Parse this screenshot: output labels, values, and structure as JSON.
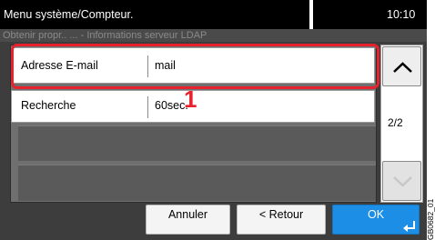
{
  "header": {
    "title": "Menu système/Compteur.",
    "time": "10:10",
    "subtitle": "Obtenir propr.. ... - Informations serveur LDAP"
  },
  "rows": [
    {
      "label": "Adresse E-mail",
      "value": "mail"
    },
    {
      "label": "Recherche",
      "value": "60sec."
    }
  ],
  "callout": "1",
  "pager": {
    "page": "2/2"
  },
  "buttons": {
    "cancel": "Annuler",
    "back": "< Retour",
    "ok": "OK"
  },
  "icons": {
    "up": "chevron-up-icon",
    "down": "chevron-down-icon",
    "enter": "enter-arrow-icon"
  },
  "colors": {
    "highlight": "#e8222d",
    "ok_button": "#1c8ee6",
    "header": "#000000"
  },
  "watermark": "GB0682_01"
}
